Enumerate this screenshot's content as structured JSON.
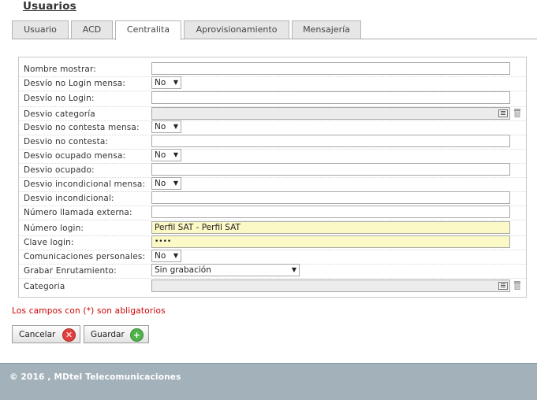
{
  "page": {
    "title": "Usuarios"
  },
  "tabs": [
    {
      "label": "Usuario"
    },
    {
      "label": "ACD"
    },
    {
      "label": "Centralita"
    },
    {
      "label": "Aprovisionamiento"
    },
    {
      "label": "Mensajería"
    }
  ],
  "active_tab": "Centralita",
  "form": {
    "nombre_mostrar": {
      "label": "Nombre mostrar:",
      "value": ""
    },
    "desvio_no_login_mensa": {
      "label": "Desvío no Login mensa:",
      "value": "No"
    },
    "desvio_no_login": {
      "label": "Desvío no Login:",
      "value": ""
    },
    "desvio_categoria": {
      "label": "Desvio categoría",
      "value": ""
    },
    "desvio_no_contesta_mensa": {
      "label": "Desvio no contesta mensa:",
      "value": "No"
    },
    "desvio_no_contesta": {
      "label": "Desvio no contesta:",
      "value": ""
    },
    "desvio_ocupado_mensa": {
      "label": "Desvio ocupado mensa:",
      "value": "No"
    },
    "desvio_ocupado": {
      "label": "Desvio ocupado:",
      "value": ""
    },
    "desvio_incondicional_mensa": {
      "label": "Desvio incondicional mensa:",
      "value": "No"
    },
    "desvio_incondicional": {
      "label": "Desvio incondicional:",
      "value": ""
    },
    "numero_llamada_externa": {
      "label": "Número llamada externa:",
      "value": ""
    },
    "numero_login": {
      "label": "Número login:",
      "value": "Perfil SAT - Perfil SAT"
    },
    "clave_login": {
      "label": "Clave login:",
      "value": "••••"
    },
    "comunicaciones_personales": {
      "label": "Comunicaciones personales:",
      "value": "No"
    },
    "grabar_enrutamiento": {
      "label": "Grabar Enrutamiento:",
      "value": "Sin grabación"
    },
    "categoria": {
      "label": "Categoria",
      "value": ""
    }
  },
  "required_note": "Los campos con (*) son abligatorios",
  "buttons": {
    "cancel": {
      "label": "Cancelar"
    },
    "save": {
      "label": "Guardar"
    }
  },
  "footer": {
    "text": "© 2016 , MDtel Telecomunicaciones"
  },
  "colors": {
    "footer_bg": "#a3b2ba",
    "required_text": "#cc0000",
    "highlight_field": "#fbf9c6",
    "cancel_icon": "#e0403e",
    "save_icon": "#4fb34a"
  }
}
